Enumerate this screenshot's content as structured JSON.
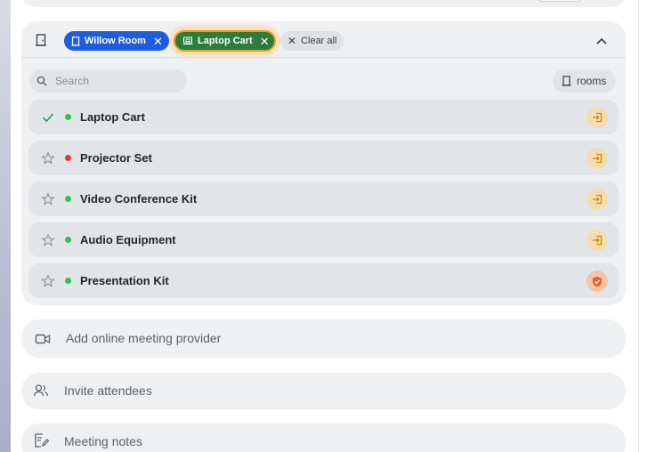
{
  "colors": {
    "room_chip": "#1f5de0",
    "cart_chip": "#2a7d3a",
    "cart_chip_outline": "#f29a1e",
    "available": "#2fbf5b",
    "unavailable": "#e53935",
    "check": "#1e9e4a"
  },
  "selection": {
    "chips": [
      {
        "label": "Willow Room",
        "icon": "door-icon"
      },
      {
        "label": "Laptop Cart",
        "icon": "laptop-cart-icon"
      }
    ],
    "clear_all_label": "Clear all"
  },
  "search": {
    "placeholder": "Search",
    "value": ""
  },
  "filter": {
    "label": "rooms",
    "icon": "door-icon"
  },
  "resources": [
    {
      "name": "Laptop Cart",
      "selected": true,
      "status": "available",
      "action_icon": "enter-icon"
    },
    {
      "name": "Projector Set",
      "selected": false,
      "status": "unavailable",
      "action_icon": "enter-icon"
    },
    {
      "name": "Video Conference Kit",
      "selected": false,
      "status": "available",
      "action_icon": "enter-icon"
    },
    {
      "name": "Audio Equipment",
      "selected": false,
      "status": "available",
      "action_icon": "enter-icon"
    },
    {
      "name": "Presentation Kit",
      "selected": false,
      "status": "available",
      "action_icon": "shield-check-icon"
    }
  ],
  "sections": {
    "online_meeting": "Add online meeting provider",
    "invite": "Invite attendees",
    "notes": "Meeting notes"
  }
}
